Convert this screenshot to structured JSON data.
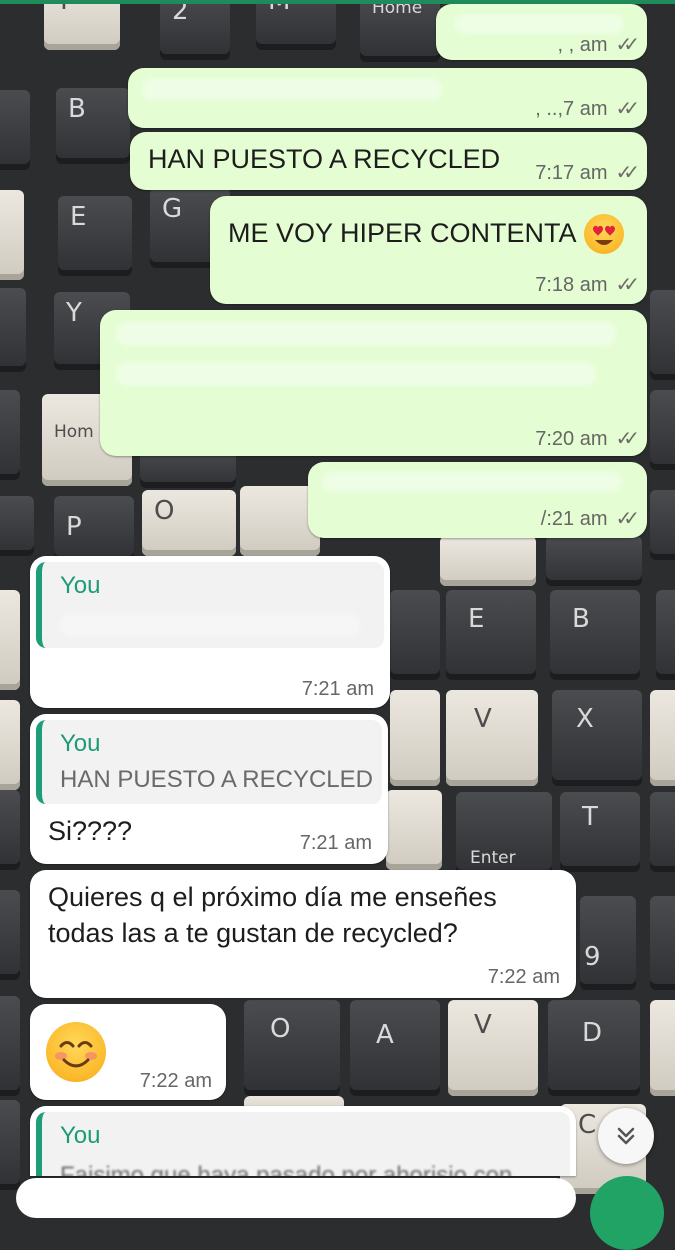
{
  "wallpaper": {
    "key_labels": [
      "Y",
      "2",
      "M",
      "Home",
      "B",
      "E",
      "G",
      "Y",
      "Hom",
      "P",
      "O",
      "E",
      "B",
      "V",
      "X",
      "T",
      "Enter",
      "9",
      "O",
      "A",
      "V",
      "D",
      "C"
    ]
  },
  "messages": [
    {
      "id": "m1",
      "dir": "out",
      "text": "",
      "time": ", , am"
    },
    {
      "id": "m2",
      "dir": "out",
      "text": "",
      "time": ", ..,7 am"
    },
    {
      "id": "m3",
      "dir": "out",
      "text": "HAN PUESTO A RECYCLED",
      "time": "7:17 am"
    },
    {
      "id": "m4",
      "dir": "out",
      "text": "ME VOY HIPER CONTENTA",
      "time": "7:18 am",
      "emoji": "heart-eyes"
    },
    {
      "id": "m5",
      "dir": "out",
      "text": "",
      "time": "7:20 am"
    },
    {
      "id": "m6",
      "dir": "out",
      "text": "",
      "time": "/:21 am"
    },
    {
      "id": "m7",
      "dir": "in",
      "reply_to": {
        "name": "You",
        "text": ""
      },
      "text": "",
      "time": "7:21 am"
    },
    {
      "id": "m8",
      "dir": "in",
      "reply_to": {
        "name": "You",
        "text": "HAN PUESTO A RECYCLED"
      },
      "text": "Si????",
      "time": "7:21 am"
    },
    {
      "id": "m9",
      "dir": "in",
      "text_line1": "Quieres q el próximo día me enseñes",
      "text_line2": "todas las a te gustan de recycled?",
      "time": "7:22 am"
    },
    {
      "id": "m10",
      "dir": "in",
      "emoji": "smiling-face",
      "time": "7:22 am"
    },
    {
      "id": "m11",
      "dir": "in",
      "reply_to": {
        "name": "You",
        "text": "Faisimo que haya pasado por ahorisio con"
      }
    }
  ],
  "colors": {
    "outgoing_bubble": "#e4fdd2",
    "incoming_bubble": "#ffffff",
    "quote_accent": "#1e9e78",
    "send_button": "#21a366"
  }
}
